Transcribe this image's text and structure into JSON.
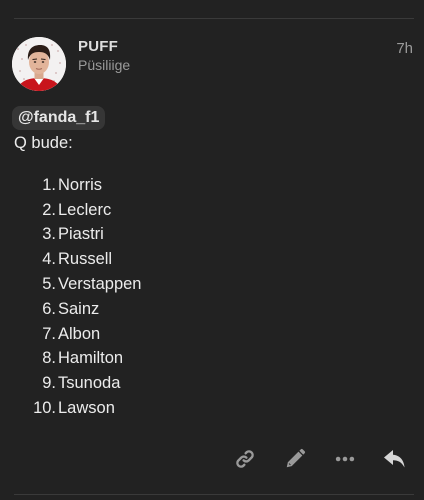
{
  "post": {
    "username": "PUFF",
    "user_title": "Püsiliige",
    "date": "7h",
    "mention": "@fanda_f1",
    "text": "Q bude:",
    "ranking": [
      {
        "num": "1.",
        "name": "Norris"
      },
      {
        "num": "2.",
        "name": "Leclerc"
      },
      {
        "num": "3.",
        "name": "Piastri"
      },
      {
        "num": "4.",
        "name": "Russell"
      },
      {
        "num": "5.",
        "name": "Verstappen"
      },
      {
        "num": "6.",
        "name": "Sainz"
      },
      {
        "num": "7.",
        "name": "Albon"
      },
      {
        "num": "8.",
        "name": "Hamilton"
      },
      {
        "num": "9.",
        "name": "Tsunoda"
      },
      {
        "num": "10.",
        "name": "Lawson"
      }
    ]
  },
  "actions": [
    {
      "name": "copy-link-button",
      "icon": "link-icon"
    },
    {
      "name": "edit-button",
      "icon": "pencil-icon"
    },
    {
      "name": "more-options-button",
      "icon": "ellipsis-icon"
    },
    {
      "name": "reply-button",
      "icon": "reply-icon"
    }
  ],
  "colors": {
    "background": "#222222",
    "text": "#ececec",
    "muted": "#9a9a9a",
    "mention_bg": "#363636",
    "icon": "#9a9a9a",
    "reply_icon": "#d6d6d6"
  }
}
